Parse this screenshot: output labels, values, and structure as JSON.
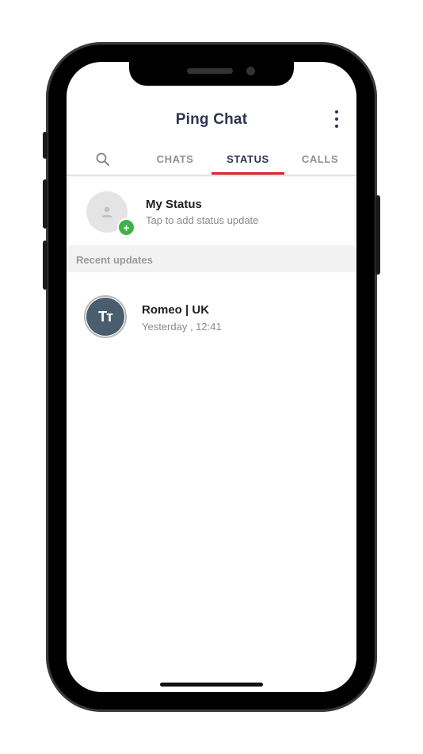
{
  "app": {
    "title": "Ping Chat"
  },
  "tabs": [
    {
      "label": "CHATS",
      "active": false
    },
    {
      "label": "STATUS",
      "active": true
    },
    {
      "label": "CALLS",
      "active": false
    }
  ],
  "my_status": {
    "name": "My Status",
    "subtitle": "Tap to add status update",
    "badge": "+"
  },
  "recent": {
    "header": "Recent updates",
    "items": [
      {
        "initials": "Tт",
        "name": "Romeo | UK",
        "time": "Yesterday , 12:41"
      }
    ]
  },
  "icons": {
    "search": "search-icon",
    "menu": "more-vertical-icon",
    "avatar_placeholder": "person-icon",
    "add": "plus-icon"
  },
  "colors": {
    "accent": "#e0242b",
    "title": "#2d3350",
    "add_badge": "#3cb34a",
    "contact_avatar": "#4a5d6e"
  }
}
